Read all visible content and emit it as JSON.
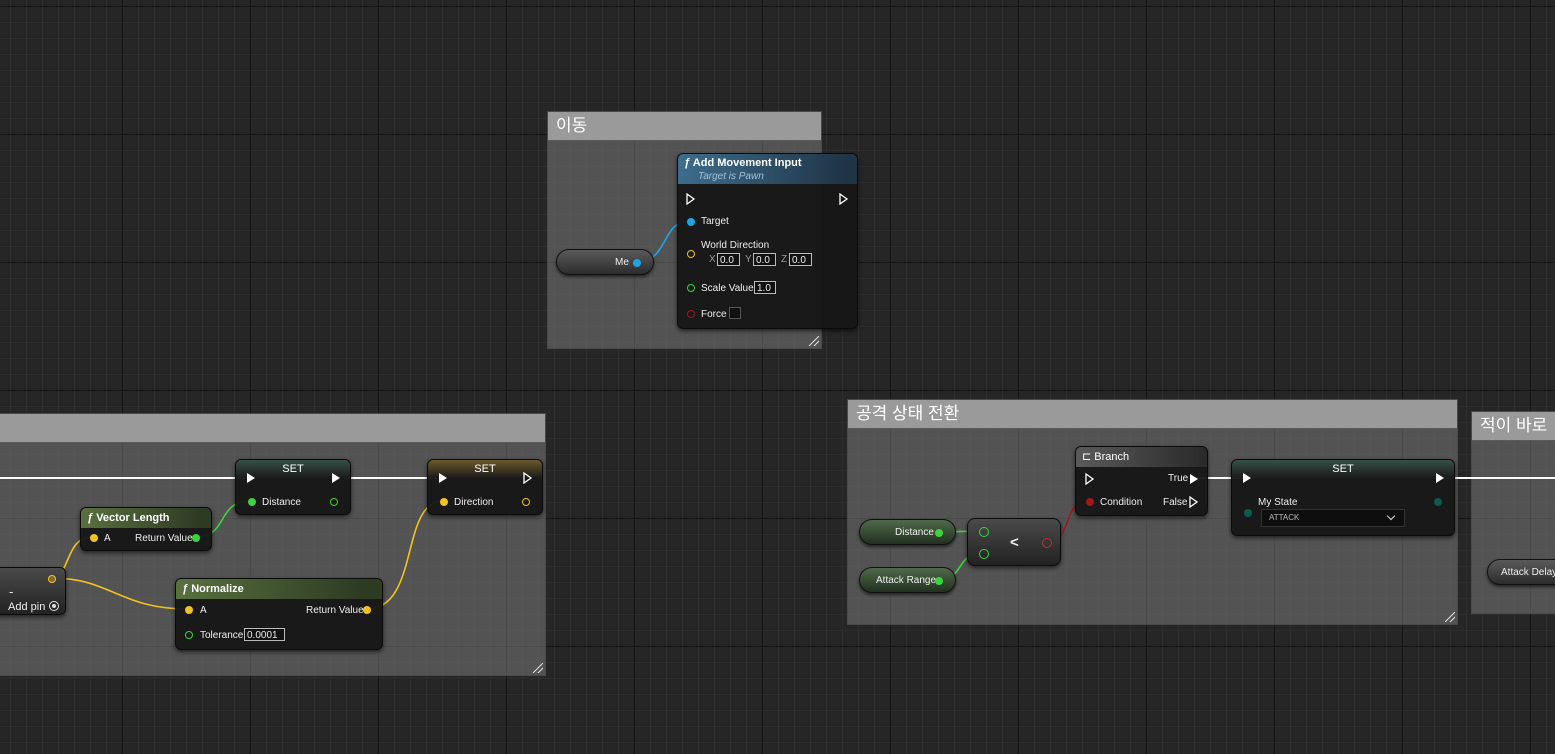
{
  "comments": {
    "move": "이동",
    "left": "",
    "attack": "공격 상태 전환",
    "right": "적이 바로"
  },
  "add_movement": {
    "title": "Add Movement Input",
    "subtitle": "Target is Pawn",
    "target": "Target",
    "world_direction": "World Direction",
    "x_label": "X",
    "x": "0.0",
    "y_label": "Y",
    "y": "0.0",
    "z_label": "Z",
    "z": "0.0",
    "scale_label": "Scale Value",
    "scale": "1.0",
    "force_label": "Force"
  },
  "me_node": {
    "label": "Me"
  },
  "vector_length": {
    "title": "Vector Length",
    "a": "A",
    "ret": "Return Value"
  },
  "set_distance": {
    "title": "SET",
    "label": "Distance"
  },
  "set_direction": {
    "title": "SET",
    "label": "Direction"
  },
  "normalize": {
    "title": "Normalize",
    "a": "A",
    "ret": "Return Value",
    "tol_label": "Tolerance",
    "tol": "0.0001"
  },
  "minus_node": {
    "symbol": "-",
    "add_pin": "Add pin"
  },
  "distance_var": {
    "label": "Distance"
  },
  "attack_range_var": {
    "label": "Attack Range"
  },
  "compare": {
    "symbol": "<"
  },
  "branch": {
    "title": "Branch",
    "condition": "Condition",
    "true": "True",
    "false": "False"
  },
  "set_state": {
    "title": "SET",
    "label": "My State",
    "value": "ATTACK"
  },
  "attack_delay": {
    "label": "Attack Delay"
  },
  "colors": {
    "exec": "#ffffff",
    "float": "#3bd53b",
    "vector": "#f3c21b",
    "object": "#1aa6e6",
    "bool": "#8c0a0a",
    "enum": "#0b5b4f"
  }
}
